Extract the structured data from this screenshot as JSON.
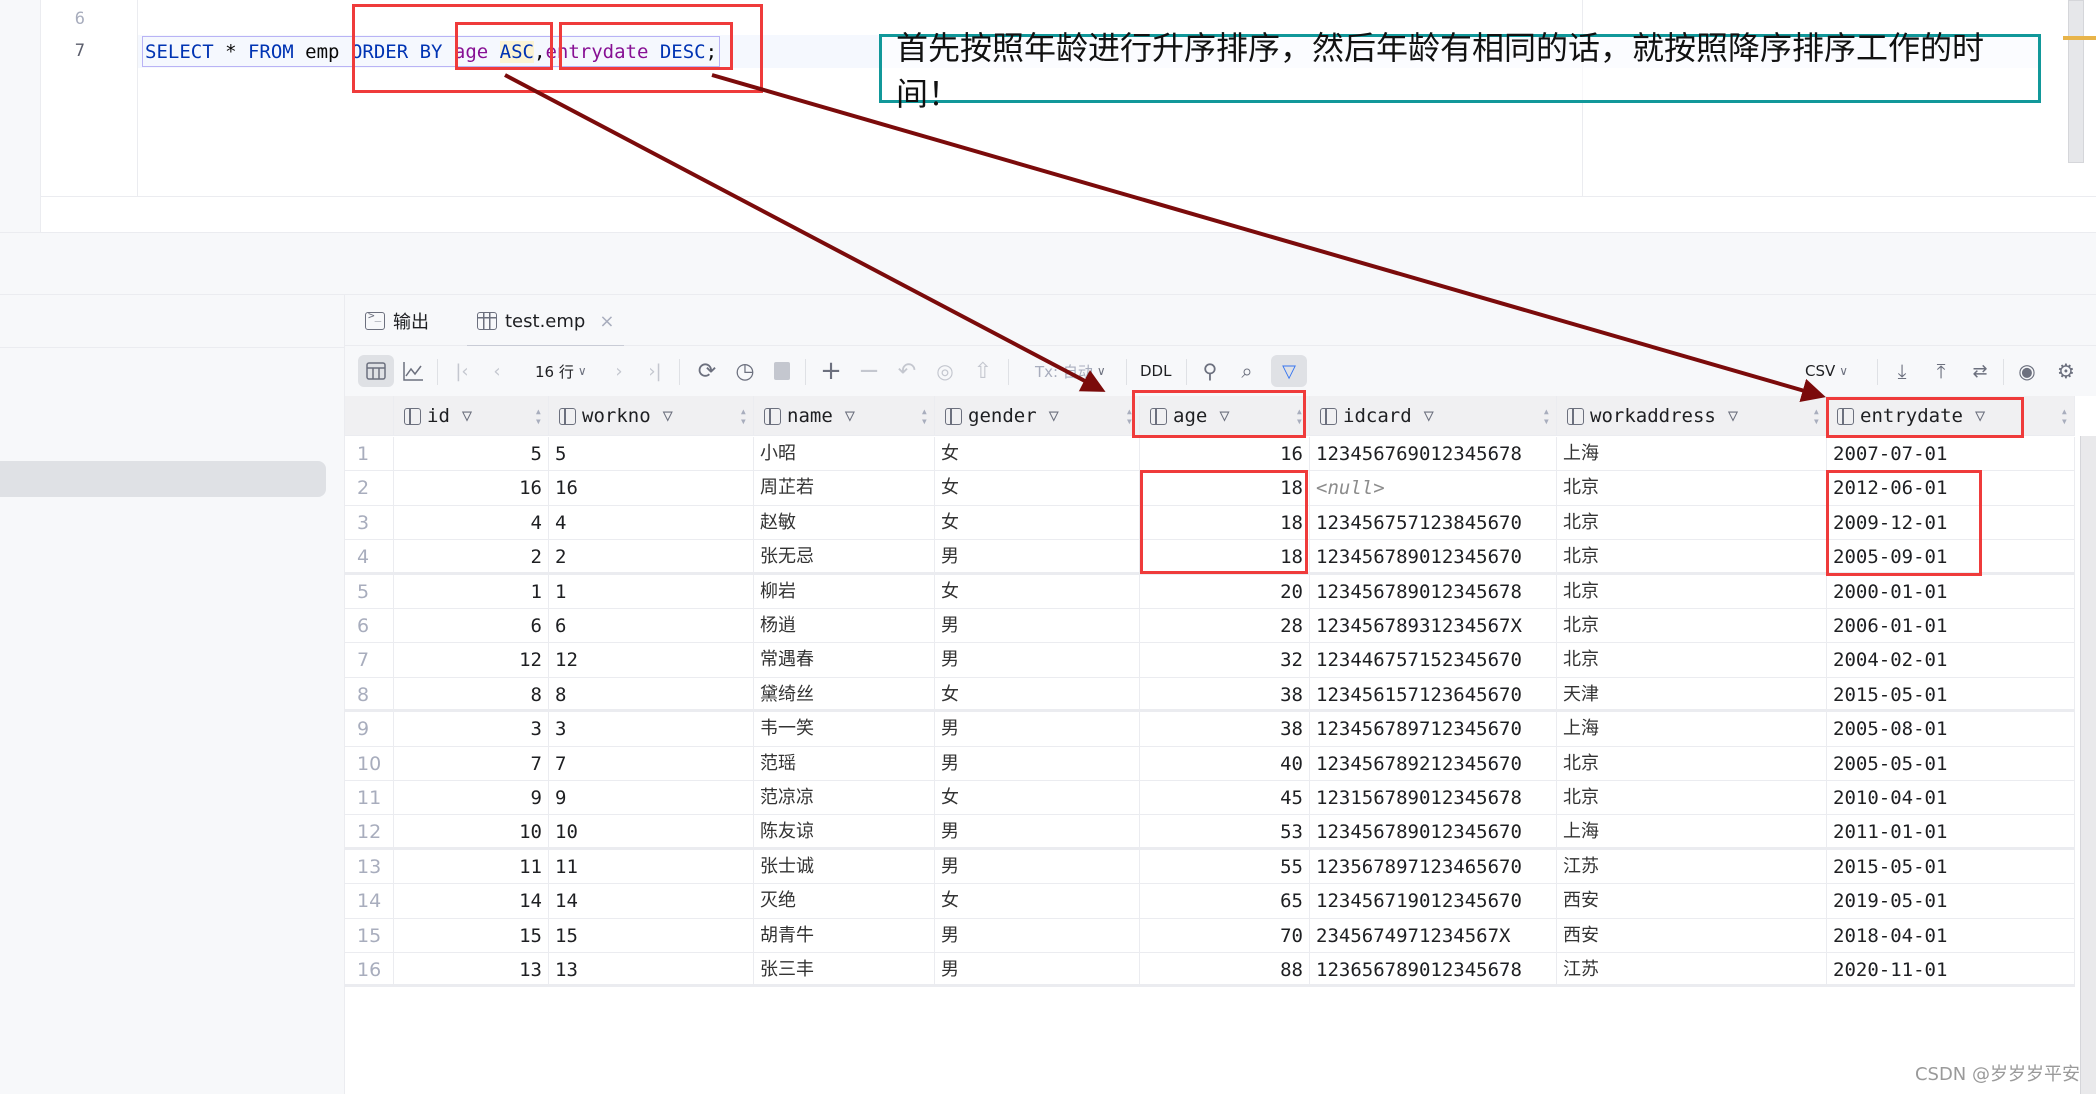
{
  "editor": {
    "lines": [
      {
        "number": "6",
        "code": ""
      },
      {
        "number": "7",
        "code": "SELECT * FROM emp ORDER BY age ASC,entrydate DESC;"
      }
    ],
    "tokens": {
      "select": "SELECT",
      "star": " * ",
      "from": "FROM",
      "table": " emp ",
      "order_by": "ORDER BY",
      "age": " age ",
      "asc": "ASC",
      "comma": ",",
      "entrydate": "entrydate",
      "desc": " DESC",
      "semicolon": ";"
    }
  },
  "annotation": {
    "note": "首先按照年龄进行升序排序，然后年龄有相同的话，就按照降序排序工作的时间！",
    "note_border_color": "#11989a",
    "highlight_color": "#ef3b3b",
    "arrow_color": "#7b0b0b"
  },
  "tabs": [
    {
      "label": "输出",
      "icon": "console-icon",
      "active": false
    },
    {
      "label": "test.emp",
      "icon": "table-icon",
      "active": true,
      "closable": true
    }
  ],
  "toolbar": {
    "row_count": "16 行",
    "tx_mode": "Tx: 自动",
    "ddl": "DDL",
    "export_format": "CSV"
  },
  "grid": {
    "columns": [
      "id",
      "workno",
      "name",
      "gender",
      "age",
      "idcard",
      "workaddress",
      "entrydate"
    ],
    "rows": [
      {
        "n": "1",
        "id": "5",
        "workno": "5",
        "name": "小昭",
        "gender": "女",
        "age": "16",
        "idcard": "123456769012345678",
        "workaddress": "上海",
        "entrydate": "2007-07-01"
      },
      {
        "n": "2",
        "id": "16",
        "workno": "16",
        "name": "周芷若",
        "gender": "女",
        "age": "18",
        "idcard": "<null>",
        "workaddress": "北京",
        "entrydate": "2012-06-01"
      },
      {
        "n": "3",
        "id": "4",
        "workno": "4",
        "name": "赵敏",
        "gender": "女",
        "age": "18",
        "idcard": "123456757123845670",
        "workaddress": "北京",
        "entrydate": "2009-12-01"
      },
      {
        "n": "4",
        "id": "2",
        "workno": "2",
        "name": "张无忌",
        "gender": "男",
        "age": "18",
        "idcard": "123456789012345670",
        "workaddress": "北京",
        "entrydate": "2005-09-01"
      },
      {
        "n": "5",
        "id": "1",
        "workno": "1",
        "name": "柳岩",
        "gender": "女",
        "age": "20",
        "idcard": "123456789012345678",
        "workaddress": "北京",
        "entrydate": "2000-01-01"
      },
      {
        "n": "6",
        "id": "6",
        "workno": "6",
        "name": "杨逍",
        "gender": "男",
        "age": "28",
        "idcard": "12345678931234567X",
        "workaddress": "北京",
        "entrydate": "2006-01-01"
      },
      {
        "n": "7",
        "id": "12",
        "workno": "12",
        "name": "常遇春",
        "gender": "男",
        "age": "32",
        "idcard": "123446757152345670",
        "workaddress": "北京",
        "entrydate": "2004-02-01"
      },
      {
        "n": "8",
        "id": "8",
        "workno": "8",
        "name": "黛绮丝",
        "gender": "女",
        "age": "38",
        "idcard": "123456157123645670",
        "workaddress": "天津",
        "entrydate": "2015-05-01"
      },
      {
        "n": "9",
        "id": "3",
        "workno": "3",
        "name": "韦一笑",
        "gender": "男",
        "age": "38",
        "idcard": "123456789712345670",
        "workaddress": "上海",
        "entrydate": "2005-08-01"
      },
      {
        "n": "10",
        "id": "7",
        "workno": "7",
        "name": "范瑶",
        "gender": "男",
        "age": "40",
        "idcard": "123456789212345670",
        "workaddress": "北京",
        "entrydate": "2005-05-01"
      },
      {
        "n": "11",
        "id": "9",
        "workno": "9",
        "name": "范凉凉",
        "gender": "女",
        "age": "45",
        "idcard": "123156789012345678",
        "workaddress": "北京",
        "entrydate": "2010-04-01"
      },
      {
        "n": "12",
        "id": "10",
        "workno": "10",
        "name": "陈友谅",
        "gender": "男",
        "age": "53",
        "idcard": "123456789012345670",
        "workaddress": "上海",
        "entrydate": "2011-01-01"
      },
      {
        "n": "13",
        "id": "11",
        "workno": "11",
        "name": "张士诚",
        "gender": "男",
        "age": "55",
        "idcard": "123567897123465670",
        "workaddress": "江苏",
        "entrydate": "2015-05-01"
      },
      {
        "n": "14",
        "id": "14",
        "workno": "14",
        "name": "灭绝",
        "gender": "女",
        "age": "65",
        "idcard": "123456719012345670",
        "workaddress": "西安",
        "entrydate": "2019-05-01"
      },
      {
        "n": "15",
        "id": "15",
        "workno": "15",
        "name": "胡青牛",
        "gender": "男",
        "age": "70",
        "idcard": "2345674971234567X",
        "workaddress": "西安",
        "entrydate": "2018-04-01"
      },
      {
        "n": "16",
        "id": "13",
        "workno": "13",
        "name": "张三丰",
        "gender": "男",
        "age": "88",
        "idcard": "123656789012345678",
        "workaddress": "江苏",
        "entrydate": "2020-11-01"
      }
    ]
  },
  "watermark": "CSDN @岁岁岁平安"
}
